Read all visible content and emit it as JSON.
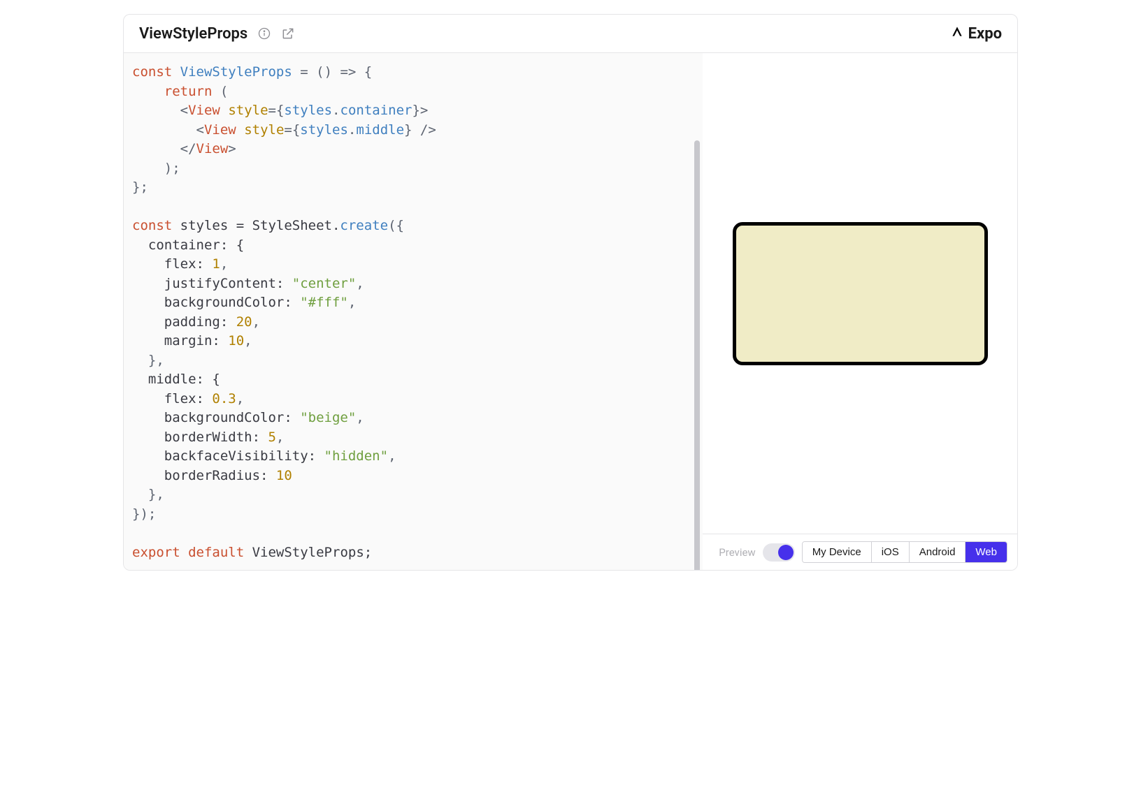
{
  "header": {
    "title": "ViewStyleProps",
    "brand": "Expo"
  },
  "code": {
    "l1_const": "const",
    "l1_name": "ViewStyleProps",
    "l1_eq": " = ",
    "l1_arrow": "() => {",
    "l2_return": "return",
    "l2_paren": " (",
    "l3_open": "<",
    "l3_view": "View",
    "l3_sp": " ",
    "l3_style": "style",
    "l3_eqb": "={",
    "l3_styles": "styles",
    "l3_dot": ".",
    "l3_container": "container",
    "l3_close": "}>",
    "l4_open": "<",
    "l4_view": "View",
    "l4_sp": " ",
    "l4_style": "style",
    "l4_eqb": "={",
    "l4_styles": "styles",
    "l4_dot": ".",
    "l4_middle": "middle",
    "l4_close": "} />",
    "l5_close": "</",
    "l5_view": "View",
    "l5_gt": ">",
    "l6": "    );",
    "l7": "};",
    "l8": "",
    "l9_const": "const",
    "l9_rest": " styles = StyleSheet.",
    "l9_create": "create",
    "l9_paren": "({",
    "l10": "  container: {",
    "l11a": "    flex: ",
    "l11n": "1",
    "l11c": ",",
    "l12a": "    justifyContent: ",
    "l12s": "\"center\"",
    "l12c": ",",
    "l13a": "    backgroundColor: ",
    "l13s": "\"#fff\"",
    "l13c": ",",
    "l14a": "    padding: ",
    "l14n": "20",
    "l14c": ",",
    "l15a": "    margin: ",
    "l15n": "10",
    "l15c": ",",
    "l16": "  },",
    "l17": "  middle: {",
    "l18a": "    flex: ",
    "l18n": "0.3",
    "l18c": ",",
    "l19a": "    backgroundColor: ",
    "l19s": "\"beige\"",
    "l19c": ",",
    "l20a": "    borderWidth: ",
    "l20n": "5",
    "l20c": ",",
    "l21a": "    backfaceVisibility: ",
    "l21s": "\"hidden\"",
    "l21c": ",",
    "l22a": "    borderRadius: ",
    "l22n": "10",
    "l23": "  },",
    "l24": "});",
    "l25": "",
    "l26_export": "export",
    "l26_sp": " ",
    "l26_default": "default",
    "l26_rest": " ViewStyleProps;"
  },
  "footer": {
    "preview_label": "Preview",
    "platforms": {
      "my_device": "My Device",
      "ios": "iOS",
      "android": "Android",
      "web": "Web"
    }
  }
}
